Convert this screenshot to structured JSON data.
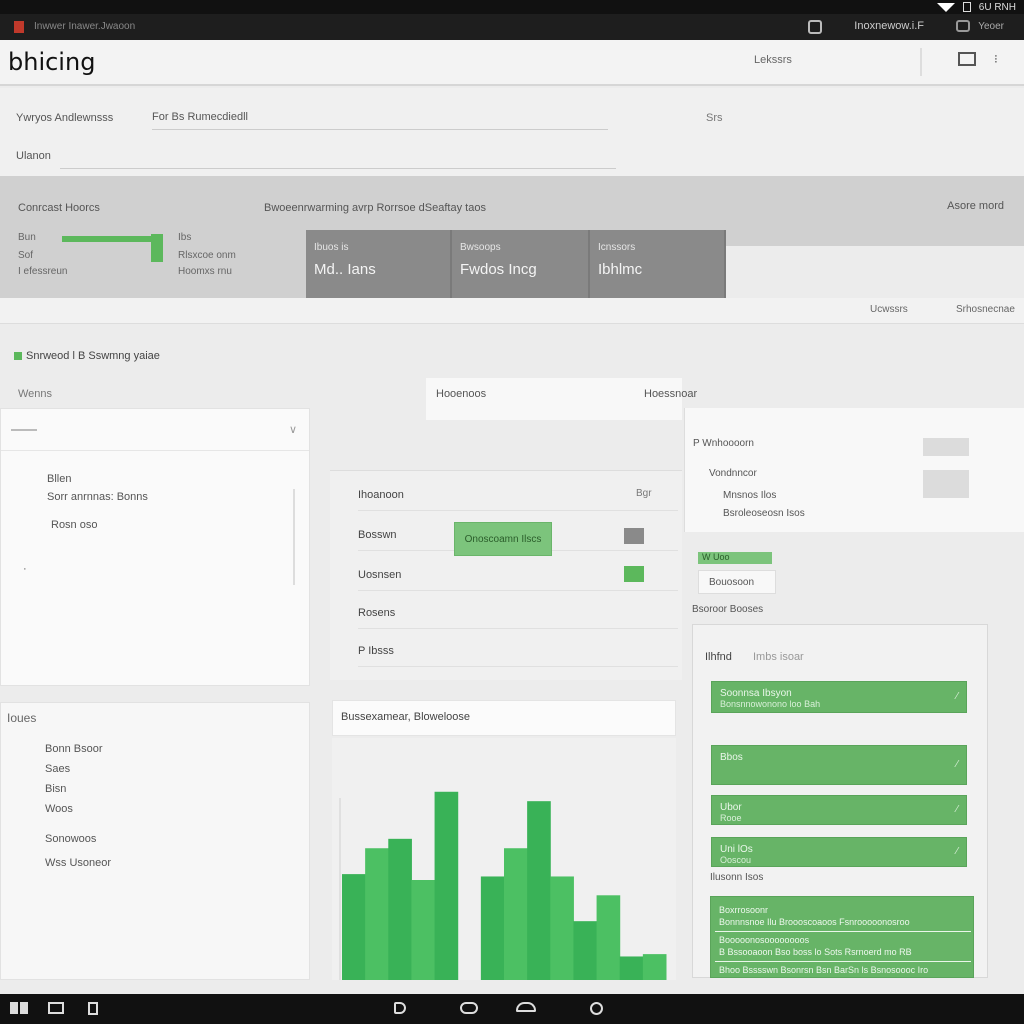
{
  "status_bar": {
    "time": "6U RNH"
  },
  "titlebar": {
    "title": "Inwwer Inawer.Jwaoon",
    "user": "Inoxnewow.i.F",
    "help": "Yeoer"
  },
  "appbar": {
    "title": "bhicing",
    "link": "Lekssrs"
  },
  "filters": {
    "label1": "Ywryos Andlewnsss",
    "value1": "For Bs Rumecdiedll",
    "label2": "Srs",
    "label3": "Ulanon"
  },
  "summary": {
    "title": "Conrcast Hoorcs",
    "description": "Bwoeenrwarming avrp Rorrsoe dSeaftay taos",
    "action": "Asore mord",
    "progress": 0.92,
    "prog_rows": [
      "Bun",
      "Sof",
      "I efessreun"
    ],
    "side_rows": [
      "Ibs",
      "Rlsxcoe onm",
      "Hoomxs rnu"
    ],
    "kpis": [
      {
        "label": "Ibuos is",
        "value": "Md.. Ians"
      },
      {
        "label": "Bwsoops",
        "value": "Fwdos Incg"
      },
      {
        "label": "Icnssors",
        "value": "Ibhlmc"
      }
    ]
  },
  "pager": {
    "prev": "Ucwssrs",
    "next": "Srhosnecnae"
  },
  "section": {
    "label": "Snrweod l B Sswmng yaiae"
  },
  "left_panel": {
    "top_label": "Wenns",
    "caret": "∨",
    "line1": "Bllen",
    "line2": "Sorr anrnnas: Bonns",
    "line3": "Rosn  oso"
  },
  "left_panel2": {
    "label": "Ioues",
    "rows": [
      "Bonn Bsoor",
      "Saes",
      "Bisn",
      "Woos",
      "Sonowoos",
      "Wss Usoneor"
    ]
  },
  "middle": {
    "tab_a": "Hooenoos",
    "tab_b": "Hoessnoar",
    "count": "Bgr",
    "rows": [
      "Ihoanoon",
      "Bosswn",
      "Uosnsen",
      "Rosens",
      "P  Ibsss"
    ],
    "button": "Onoscoamn Ilscs",
    "chart_title": "Bussexamear, Bloweloose"
  },
  "chart_data": {
    "type": "bar",
    "title": "",
    "xlabel": "",
    "ylabel": "",
    "ylim": [
      0,
      170
    ],
    "series": [
      {
        "values": [
          90,
          112,
          120,
          85,
          160,
          0,
          88,
          112,
          152,
          88,
          50,
          72,
          20,
          22
        ]
      }
    ]
  },
  "right_panel": {
    "line1": "P Wnhoooorn",
    "line2": "Vondnncor",
    "line3": "Mnsnos Ilos",
    "line4": "Bsroleoseosn Isos",
    "chip_green": "W Uoo",
    "chip2": "Bouosoon",
    "section": "Bsoroor Booses",
    "list_head": "Ilhfnd",
    "list_head_extra": "Imbs isoar",
    "items": [
      {
        "title": "Soonnsa Ibsyon",
        "meta": "Bonsnnowonono loo Bah"
      },
      {
        "title": "Bbos",
        "meta": ""
      },
      {
        "title": "Ubor",
        "meta": "Rooe"
      },
      {
        "title": "Uni lOs",
        "meta": "Ooscou"
      }
    ],
    "note": "Ilusonn  Isos",
    "details": [
      "Boxrrosoonr",
      "Bonnnsnoe  Ilu Broooscoaoos  Fsnrooooonosroo",
      "Booooonosoooooooos",
      "B Bssooaoon Bso boss lo Sots Rsrnoerd mo RB",
      "Bhoo  Bsssswn  Bsonrsn  Bsn BarSn  ls Bsnosoooc  Iro"
    ]
  },
  "colors": {
    "accent": "#5cb85c",
    "kpi_bg": "#8a8a8a",
    "summary_bg": "#d0d0d0"
  }
}
